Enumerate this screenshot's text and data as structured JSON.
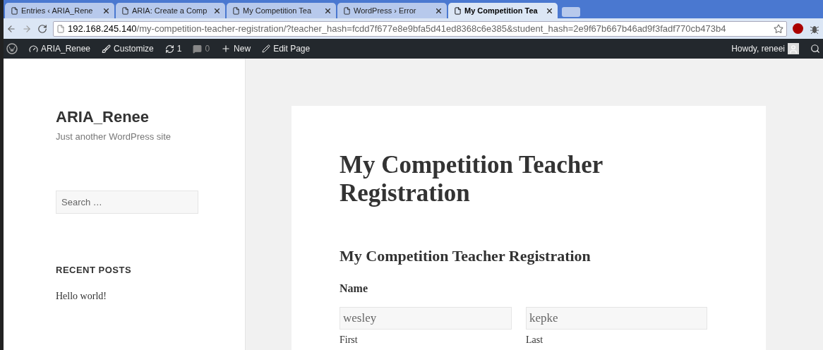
{
  "browser": {
    "tabs": [
      {
        "label": "Entries ‹ ARIA_Rene",
        "selected": false
      },
      {
        "label": "ARIA: Create a Comp",
        "selected": false
      },
      {
        "label": "My Competition Tea",
        "selected": false
      },
      {
        "label": "WordPress › Error",
        "selected": false
      },
      {
        "label": "My Competition Tea",
        "selected": true
      }
    ],
    "address": {
      "host": "192.168.245.140",
      "path": "/my-competition-teacher-registration/?teacher_hash=fcdd7f677e8e9bfa5d41ed8368c6e385&student_hash=2e9f67b667b46ad9f3fadf770cb473b4"
    }
  },
  "admin_bar": {
    "site": "ARIA_Renee",
    "customize": "Customize",
    "updates": "1",
    "comments": "0",
    "new": "New",
    "edit": "Edit Page",
    "howdy": "Howdy, reneei"
  },
  "sidebar": {
    "site_title": "ARIA_Renee",
    "tagline": "Just another WordPress site",
    "search": {
      "placeholder": "Search …"
    },
    "recent_posts_heading": "RECENT POSTS",
    "recent_posts": [
      "Hello world!"
    ]
  },
  "article": {
    "title": "My Competition Teacher Registration",
    "form_title": "My Competition Teacher Registration",
    "name_label": "Name",
    "fields": [
      {
        "value": "wesley",
        "sublabel": "First"
      },
      {
        "value": "kepke",
        "sublabel": "Last"
      }
    ]
  }
}
